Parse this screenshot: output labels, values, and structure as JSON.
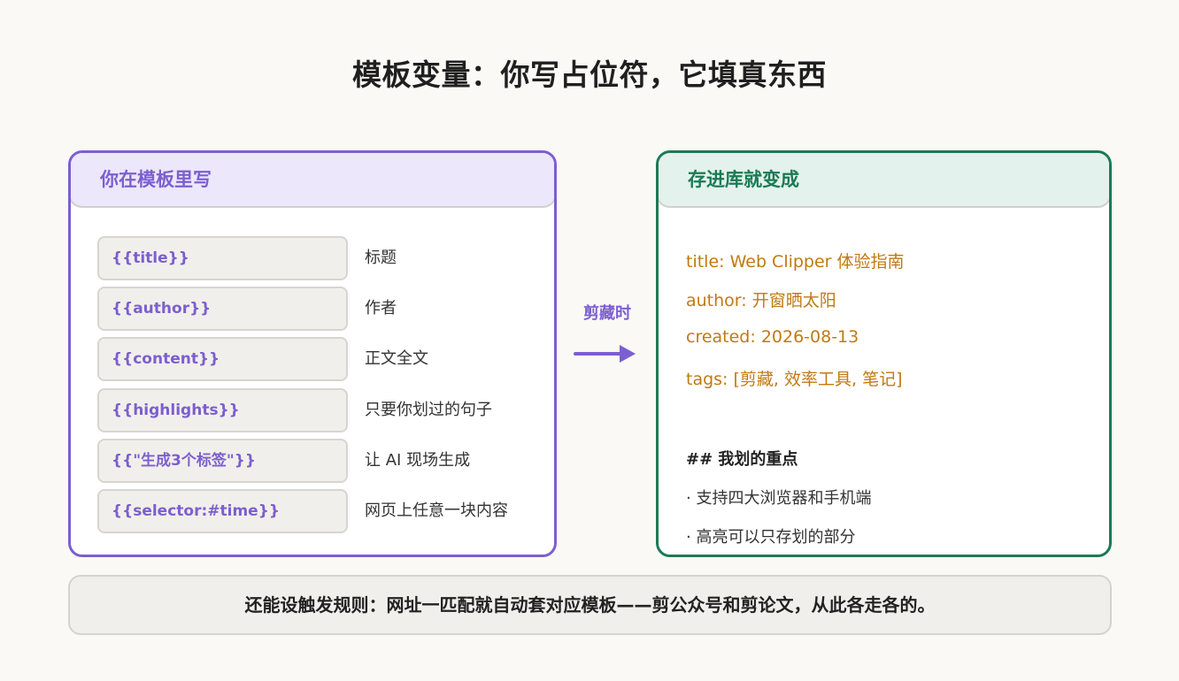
{
  "title": "模板变量：你写占位符，它填真东西",
  "left_panel": {
    "header": "你在模板里写",
    "rows": [
      {
        "code": "{{title}}",
        "desc": "标题"
      },
      {
        "code": "{{author}}",
        "desc": "作者"
      },
      {
        "code": "{{content}}",
        "desc": "正文全文"
      },
      {
        "code": "{{highlights}}",
        "desc": "只要你划过的句子"
      },
      {
        "code": "{{\"生成3个标签\"}}",
        "desc": "让 AI 现场生成"
      },
      {
        "code": "{{selector:#time}}",
        "desc": "网页上任意一块内容"
      }
    ]
  },
  "arrow": {
    "label": "剪藏时"
  },
  "right_panel": {
    "header": "存进库就变成",
    "meta_lines": [
      "title: Web Clipper 体验指南",
      "author: 开窗晒太阳",
      "created: 2026-08-13",
      "tags: [剪藏, 效率工具, 笔记]"
    ],
    "heading": "## 我划的重点",
    "bullets": [
      "· 支持四大浏览器和手机端",
      "· 高亮可以只存划的部分"
    ]
  },
  "footer": "还能设触发规则：网址一匹配就自动套对应模板——剪公众号和剪论文，从此各走各的。",
  "colors": {
    "accent_purple": "#7c5fcf",
    "accent_green": "#1b7a55",
    "meta_orange": "#c07a12"
  }
}
